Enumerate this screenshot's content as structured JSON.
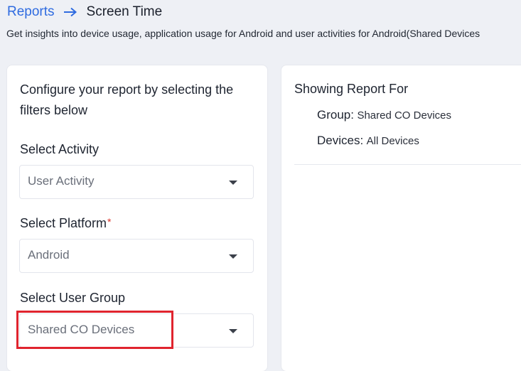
{
  "breadcrumb": {
    "parent_label": "Reports",
    "current_label": "Screen Time"
  },
  "subtitle": "Get insights into device usage, application usage for Android and user activities for Android(Shared Devices",
  "filters": {
    "intro": "Configure your report by selecting the filters below",
    "activity": {
      "label": "Select Activity",
      "value": "User Activity"
    },
    "platform": {
      "label": "Select Platform",
      "required_mark": "*",
      "value": "Android"
    },
    "user_group": {
      "label": "Select User Group",
      "value": "Shared CO Devices"
    }
  },
  "report": {
    "title": "Showing Report For",
    "group_key": "Group",
    "group_value": "Shared CO Devices",
    "devices_key": "Devices",
    "devices_value": "All Devices",
    "separator": ":"
  },
  "colors": {
    "link": "#2f6be0",
    "highlight": "#e0242e",
    "required": "#d93025"
  },
  "icons": {
    "breadcrumb_separator": "arrow-right-icon",
    "dropdown": "chevron-down-icon"
  }
}
